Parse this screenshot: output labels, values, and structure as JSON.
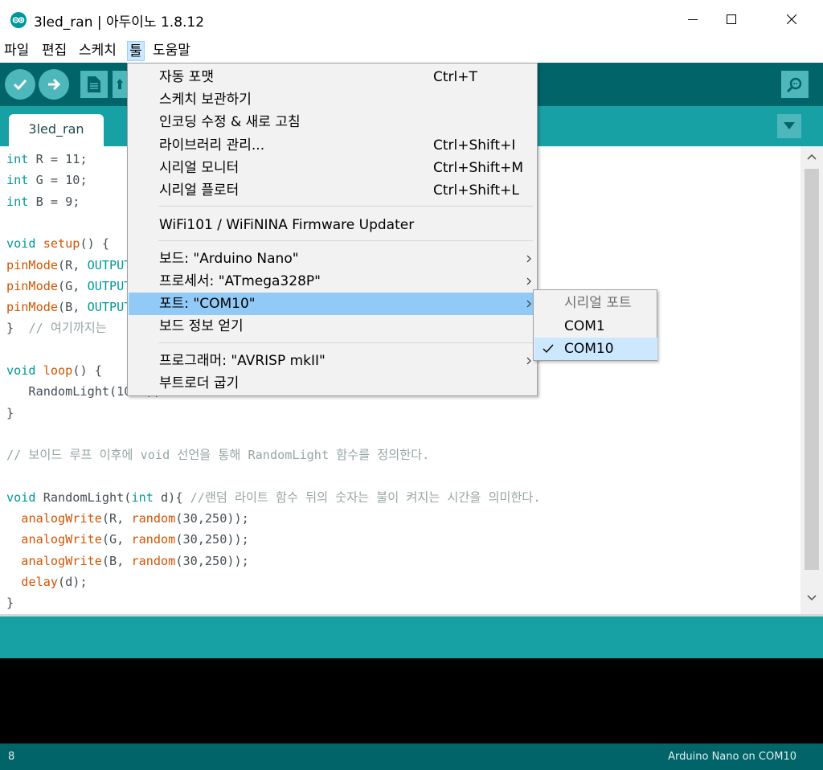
{
  "window": {
    "title": "3led_ran | 아두이노 1.8.12"
  },
  "menubar": {
    "items": [
      "파일",
      "편집",
      "스케치",
      "툴",
      "도움말"
    ],
    "active_index": 3
  },
  "toolbar": {
    "verify_icon": "checkmark-icon",
    "upload_icon": "arrow-right-icon",
    "new_icon": "new-file-icon",
    "open_icon": "open-icon",
    "serial_monitor_icon": "magnifier-icon"
  },
  "tabs": {
    "active": "3led_ran",
    "menu_icon": "triangle-down-icon"
  },
  "editor": {
    "lines": [
      [
        {
          "t": "int",
          "c": "type"
        },
        {
          "t": " R = 11;"
        }
      ],
      [
        {
          "t": "int",
          "c": "type"
        },
        {
          "t": " G = 10;"
        }
      ],
      [
        {
          "t": "int",
          "c": "type"
        },
        {
          "t": " B = 9;"
        }
      ],
      [],
      [
        {
          "t": "void",
          "c": "type"
        },
        {
          "t": " "
        },
        {
          "t": "setup",
          "c": "fn"
        },
        {
          "t": "() {"
        }
      ],
      [
        {
          "t": "pinMode",
          "c": "fn"
        },
        {
          "t": "(R, "
        },
        {
          "t": "OUTPUT",
          "c": "type"
        },
        {
          "t": ");"
        }
      ],
      [
        {
          "t": "pinMode",
          "c": "fn"
        },
        {
          "t": "(G, "
        },
        {
          "t": "OUTPUT",
          "c": "type"
        },
        {
          "t": ");"
        }
      ],
      [
        {
          "t": "pinMode",
          "c": "fn"
        },
        {
          "t": "(B, "
        },
        {
          "t": "OUTPUT",
          "c": "type"
        },
        {
          "t": ");"
        }
      ],
      [
        {
          "t": "}  "
        },
        {
          "t": "// 여기까지는",
          "c": "cmt"
        }
      ],
      [],
      [
        {
          "t": "void",
          "c": "type"
        },
        {
          "t": " "
        },
        {
          "t": "loop",
          "c": "fn"
        },
        {
          "t": "() {"
        }
      ],
      [
        {
          "t": "   RandomLight(1000);"
        }
      ],
      [
        {
          "t": "}"
        }
      ],
      [],
      [
        {
          "t": "// 보이드 루프 이후에 void 선언을 통해 RandomLight 함수를 정의한다.",
          "c": "cmt"
        }
      ],
      [],
      [
        {
          "t": "void",
          "c": "type"
        },
        {
          "t": " RandomLight("
        },
        {
          "t": "int",
          "c": "type"
        },
        {
          "t": " d){ "
        },
        {
          "t": "//랜덤 라이트 함수 뒤의 숫자는 불이 켜지는 시간을 의미한다.",
          "c": "cmt"
        }
      ],
      [
        {
          "t": "  "
        },
        {
          "t": "analogWrite",
          "c": "fn"
        },
        {
          "t": "(R, "
        },
        {
          "t": "random",
          "c": "fn"
        },
        {
          "t": "(30,250));"
        }
      ],
      [
        {
          "t": "  "
        },
        {
          "t": "analogWrite",
          "c": "fn"
        },
        {
          "t": "(G, "
        },
        {
          "t": "random",
          "c": "fn"
        },
        {
          "t": "(30,250));"
        }
      ],
      [
        {
          "t": "  "
        },
        {
          "t": "analogWrite",
          "c": "fn"
        },
        {
          "t": "(B, "
        },
        {
          "t": "random",
          "c": "fn"
        },
        {
          "t": "(30,250));"
        }
      ],
      [
        {
          "t": "  "
        },
        {
          "t": "delay",
          "c": "fn"
        },
        {
          "t": "(d);"
        }
      ],
      [
        {
          "t": "}"
        }
      ]
    ]
  },
  "tools_menu": {
    "items": [
      {
        "label": "자동 포맷",
        "shortcut": "Ctrl+T"
      },
      {
        "label": "스케치 보관하기",
        "shortcut": ""
      },
      {
        "label": "인코딩 수정 & 새로 고침",
        "shortcut": ""
      },
      {
        "label": "라이브러리 관리...",
        "shortcut": "Ctrl+Shift+I"
      },
      {
        "label": "시리얼 모니터",
        "shortcut": "Ctrl+Shift+M"
      },
      {
        "label": "시리얼 플로터",
        "shortcut": "Ctrl+Shift+L"
      },
      {
        "label": "WiFi101 / WiFiNINA Firmware Updater",
        "shortcut": ""
      },
      {
        "label": "보드: \"Arduino Nano\"",
        "submenu": true
      },
      {
        "label": "프로세서: \"ATmega328P\"",
        "submenu": true
      },
      {
        "label": "포트: \"COM10\"",
        "submenu": true,
        "highlighted": true
      },
      {
        "label": "보드 정보 얻기",
        "shortcut": ""
      },
      {
        "label": "프로그래머: \"AVRISP mkII\"",
        "submenu": true
      },
      {
        "label": "부트로더 굽기",
        "shortcut": ""
      }
    ]
  },
  "port_submenu": {
    "header": "시리얼 포트",
    "items": [
      {
        "label": "COM1",
        "checked": false
      },
      {
        "label": "COM10",
        "checked": true
      }
    ]
  },
  "footer": {
    "line_number": "8",
    "board_status": "Arduino Nano on COM10"
  },
  "colors": {
    "teal_dark": "#006468",
    "teal": "#17a1a5",
    "button": "#4db7bb",
    "highlight": "#91c9f7"
  }
}
